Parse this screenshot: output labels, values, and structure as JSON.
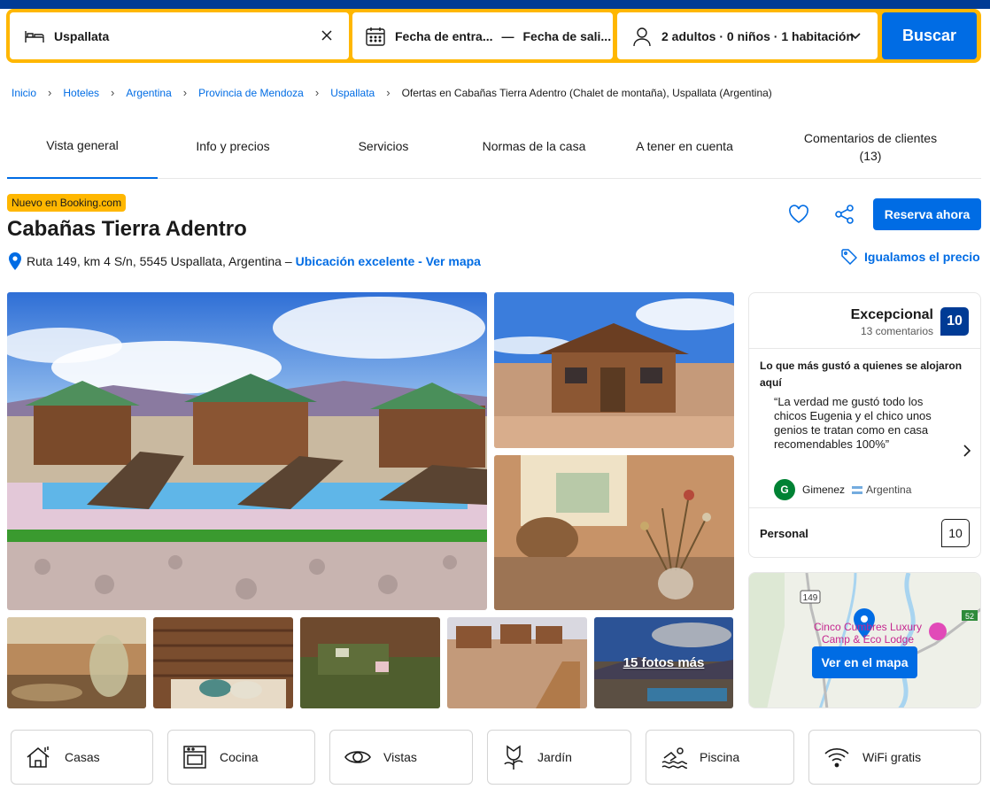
{
  "search": {
    "destination": "Uspallata",
    "checkin": "Fecha de entra...",
    "date_separator": "—",
    "checkout": "Fecha de sali...",
    "guests": "2 adultos · 0 niños · 1 habitación",
    "button": "Buscar"
  },
  "breadcrumb": {
    "items": [
      "Inicio",
      "Hoteles",
      "Argentina",
      "Provincia de Mendoza",
      "Uspallata"
    ],
    "current": "Ofertas en Cabañas Tierra Adentro (Chalet de montaña), Uspallata (Argentina)"
  },
  "tabs": [
    {
      "label": "Vista general"
    },
    {
      "label": "Info y precios"
    },
    {
      "label": "Servicios"
    },
    {
      "label": "Normas de la casa"
    },
    {
      "label": "A tener en cuenta"
    },
    {
      "label": "Comentarios de clientes (13)"
    }
  ],
  "property": {
    "badge": "Nuevo en Booking.com",
    "name": "Cabañas Tierra Adentro",
    "address": "Ruta 149, km 4 S/n, 5545 Uspallata, Argentina –",
    "location_link": "Ubicación excelente - Ver mapa",
    "reserve_button": "Reserva ahora",
    "price_match": "Igualamos el precio"
  },
  "gallery": {
    "more_photos": "15 fotos más"
  },
  "review": {
    "label": "Excepcional",
    "count": "13 comentarios",
    "score": "10",
    "liked_heading": "Lo que más gustó a quienes se alojaron aquí",
    "quote": "“La verdad me gustó todo los chicos Eugenia y el chico unos genios te tratan como en casa recomendables 100%”",
    "reviewer_initial": "G",
    "reviewer_name": "Gimenez",
    "reviewer_country": "Argentina",
    "subscore_label": "Personal",
    "subscore_value": "10"
  },
  "map": {
    "poi_label": "Cinco Cumbres Luxury Camp & Eco Lodge",
    "route_149": "149",
    "route_52": "52",
    "button": "Ver en el mapa"
  },
  "amenities": [
    {
      "label": "Casas",
      "icon": "house-icon"
    },
    {
      "label": "Cocina",
      "icon": "oven-icon"
    },
    {
      "label": "Vistas",
      "icon": "eye-icon"
    },
    {
      "label": "Jardín",
      "icon": "flower-icon"
    },
    {
      "label": "Piscina",
      "icon": "swimmer-icon"
    },
    {
      "label": "WiFi gratis",
      "icon": "wifi-icon"
    }
  ],
  "colors": {
    "brand_dark": "#003b95",
    "brand_blue": "#006ce4",
    "search_yellow": "#ffb700"
  }
}
